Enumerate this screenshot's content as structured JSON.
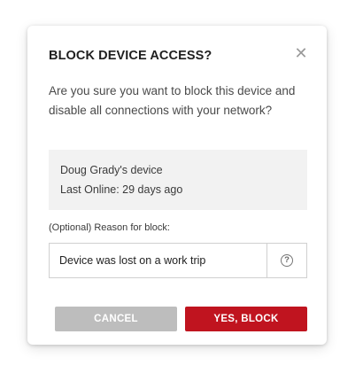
{
  "dialog": {
    "title": "BLOCK DEVICE ACCESS?",
    "close_icon": "close-icon",
    "message": "Are you sure you want to block this device and disable all connections with your network?",
    "device": {
      "name": "Doug Grady's device",
      "last_online": "Last Online: 29 days ago"
    },
    "reason": {
      "label": "(Optional) Reason for block:",
      "value": "Device was lost on a work trip",
      "help_icon": "help-circle-icon"
    },
    "buttons": {
      "cancel": "CANCEL",
      "confirm": "YES, BLOCK"
    }
  },
  "colors": {
    "confirm_button": "#c0141f",
    "cancel_button": "#bdbdbd",
    "device_box": "#f2f2f2"
  }
}
